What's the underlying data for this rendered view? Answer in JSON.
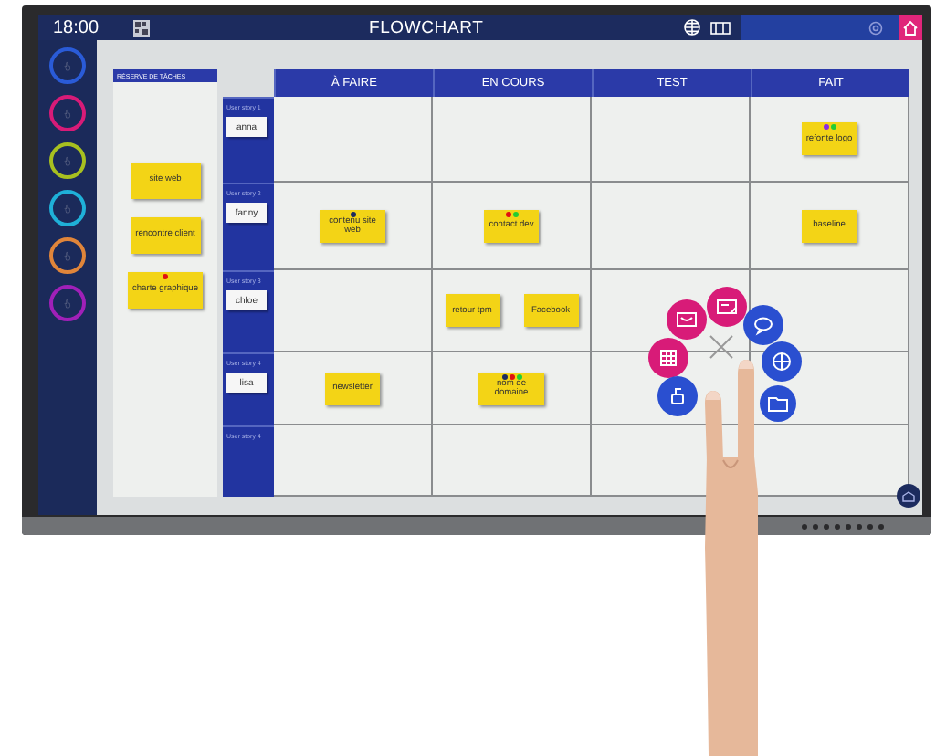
{
  "top_bar": {
    "time": "18:00",
    "title": "FLOWCHART"
  },
  "sidebar": {
    "tools": [
      {
        "color": "#2a5bd7"
      },
      {
        "color": "#d81b78"
      },
      {
        "color": "#a8c020"
      },
      {
        "color": "#1fb0d8"
      },
      {
        "color": "#e0853a"
      },
      {
        "color": "#a020b8"
      }
    ]
  },
  "reserve": {
    "title": "RÉSERVE DE TÂCHES",
    "notes": [
      {
        "text": "site web"
      },
      {
        "text": "rencontre client"
      },
      {
        "text": "charte graphique",
        "dots": [
          {
            "color": "#e01010"
          }
        ]
      }
    ]
  },
  "board": {
    "columns": [
      "À FAIRE",
      "EN COURS",
      "TEST",
      "FAIT"
    ],
    "rows": [
      {
        "story": "User story 1",
        "person": "anna",
        "cells": [
          {},
          {},
          {},
          {
            "notes": [
              {
                "text": "refonte logo",
                "dots": [
                  {
                    "color": "#8a2be2"
                  },
                  {
                    "color": "#22cc33"
                  }
                ]
              }
            ]
          }
        ]
      },
      {
        "story": "User story 2",
        "person": "fanny",
        "cells": [
          {
            "notes": [
              {
                "text": "contenu site web",
                "dots": [
                  {
                    "color": "#1c2b5e"
                  }
                ]
              }
            ]
          },
          {
            "notes": [
              {
                "text": "contact dev",
                "dots": [
                  {
                    "color": "#e01010"
                  },
                  {
                    "color": "#22cc33"
                  }
                ]
              }
            ]
          },
          {},
          {
            "notes": [
              {
                "text": "baseline"
              }
            ]
          }
        ]
      },
      {
        "story": "User story 3",
        "person": "chloe",
        "cells": [
          {},
          {
            "notes": [
              {
                "text": "retour tpm"
              },
              {
                "text": "Facebook"
              }
            ]
          },
          {},
          {}
        ]
      },
      {
        "story": "User story 4",
        "person": "lisa",
        "cells": [
          {
            "notes": [
              {
                "text": "newsletter"
              }
            ]
          },
          {
            "notes": [
              {
                "text": "nom de domaine",
                "dots": [
                  {
                    "color": "#1c2b5e"
                  },
                  {
                    "color": "#e01010"
                  },
                  {
                    "color": "#22cc33"
                  }
                ]
              }
            ]
          },
          {},
          {}
        ]
      },
      {
        "story": "User story 4",
        "cells": [
          {},
          {},
          {},
          {}
        ]
      }
    ]
  },
  "radial_menu": {
    "items": [
      {
        "color": "#d81b78"
      },
      {
        "color": "#d81b78"
      },
      {
        "color": "#d81b78"
      },
      {
        "color": "#2a4fd0"
      },
      {
        "color": "#2a4fd0"
      },
      {
        "color": "#2a4fd0"
      },
      {
        "color": "#2a4fd0"
      }
    ]
  }
}
